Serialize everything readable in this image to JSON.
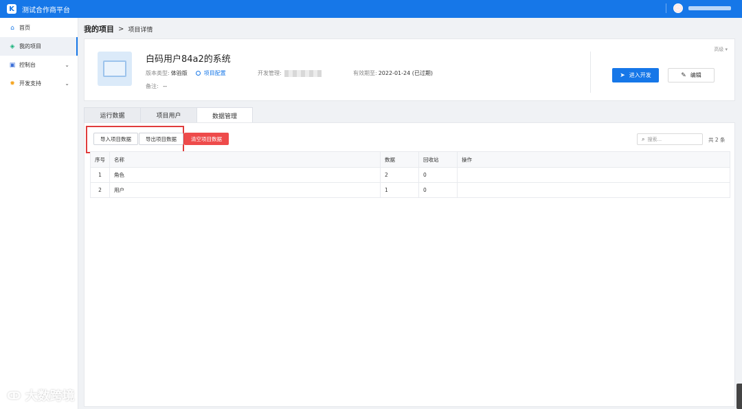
{
  "app": {
    "title": "测试合作商平台"
  },
  "sidebar": {
    "items": [
      {
        "label": "首页",
        "icon": "home-icon"
      },
      {
        "label": "我的项目",
        "icon": "layers-icon"
      },
      {
        "label": "控制台",
        "icon": "monitor-icon"
      },
      {
        "label": "开发支持",
        "icon": "gear-icon"
      }
    ]
  },
  "breadcrumb": {
    "main": "我的项目",
    "sep": ">",
    "sub": "项目详情"
  },
  "project": {
    "title": "白码用户84a2的系统",
    "version_label": "版本类型:",
    "version_value": "体验版",
    "config_link": "项目配置",
    "dev_label": "开发管理:",
    "expire_label": "有效期至:",
    "expire_value": "2022-01-24 (已过期)",
    "note_label": "备注:",
    "note_value": "--",
    "more": "高级 ▾",
    "enter_button": "进入开发",
    "edit_button": "编辑"
  },
  "tabs": [
    {
      "label": "运行数据"
    },
    {
      "label": "项目用户"
    },
    {
      "label": "数据管理"
    }
  ],
  "toolbar": {
    "import": "导入项目数据",
    "export": "导出项目数据",
    "clear": "清空项目数据",
    "search_placeholder": "搜索...",
    "total": "共 2 条"
  },
  "table": {
    "headers": [
      "序号",
      "名称",
      "数据",
      "回收站",
      "操作"
    ],
    "rows": [
      [
        "1",
        "角色",
        "2",
        "0",
        ""
      ],
      [
        "2",
        "用户",
        "1",
        "0",
        ""
      ]
    ]
  },
  "watermark": {
    "text": "大数跨境"
  },
  "colors": {
    "primary": "#1677e8",
    "danger": "#ee4b4b",
    "highlight": "#e03c3c"
  }
}
